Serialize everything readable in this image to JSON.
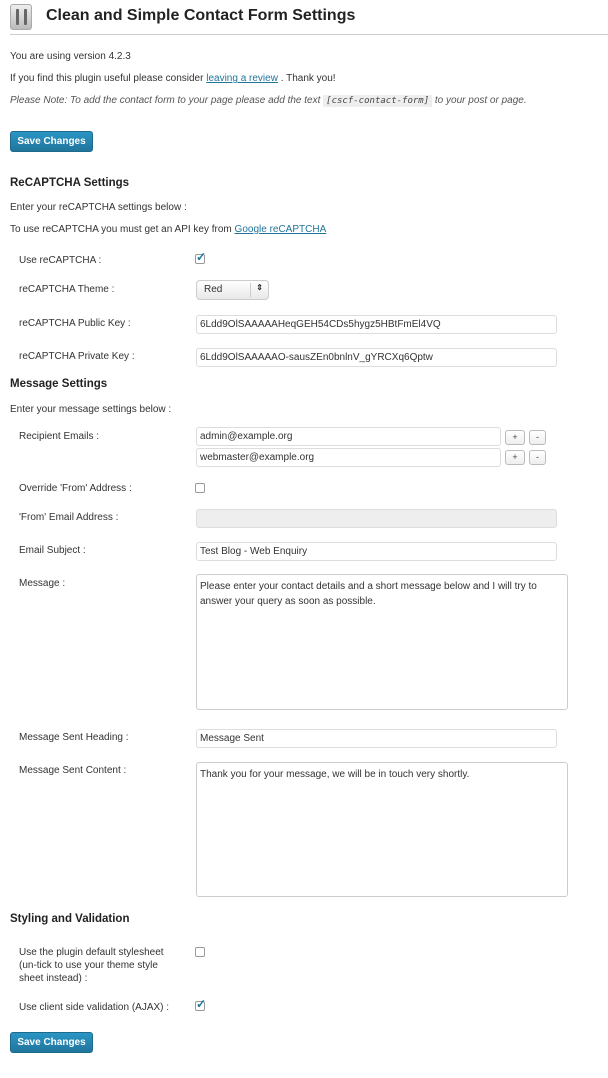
{
  "header": {
    "title": "Clean and Simple Contact Form Settings",
    "icon": "settings-sliders-icon"
  },
  "intro": {
    "version": "You are using version 4.2.3",
    "review_pre": "If you find this plugin useful please consider",
    "review_link": "leaving a review",
    "review_post": ". Thank you!",
    "note_pre": "Please Note: To add the contact form to your page please add the text",
    "shortcode": "[cscf-contact-form]",
    "note_post": "to your post or page."
  },
  "save_label": "Save Changes",
  "recaptcha": {
    "heading": "ReCAPTCHA Settings",
    "intro": "Enter your reCAPTCHA settings below :",
    "api_pre": "To use reCAPTCHA you must get an API key from",
    "api_link": "Google reCAPTCHA",
    "use_label": "Use reCAPTCHA :",
    "use_checked": true,
    "theme_label": "reCAPTCHA Theme :",
    "theme_value": "Red",
    "public_label": "reCAPTCHA Public Key :",
    "public_value": "6Ldd9OlSAAAAAHeqGEH54CDs5hygz5HBtFmEl4VQ",
    "private_label": "reCAPTCHA Private Key :",
    "private_value": "6Ldd9OlSAAAAAO-sausZEn0bnlnV_gYRCXq6Qptw"
  },
  "message": {
    "heading": "Message Settings",
    "intro": "Enter your message settings below :",
    "recipients_label": "Recipient Emails :",
    "recipients": [
      "admin@example.org",
      "webmaster@example.org"
    ],
    "add": "+",
    "remove": "-",
    "override_label": "Override 'From' Address :",
    "override_checked": false,
    "from_label": "'From' Email Address :",
    "from_value": "",
    "subject_label": "Email Subject :",
    "subject_value": "Test Blog -  Web Enquiry",
    "message_label": "Message :",
    "message_value": "Please enter your contact details and a short message below and I will try to answer your query as soon as possible.",
    "sent_heading_label": "Message Sent Heading :",
    "sent_heading_value": "Message Sent",
    "sent_content_label": "Message Sent Content :",
    "sent_content_value": "Thank you for your message, we will be in touch very shortly."
  },
  "styling": {
    "heading": "Styling and Validation",
    "stylesheet_label": "Use the plugin default stylesheet (un-tick to use your theme style sheet instead) :",
    "stylesheet_checked": false,
    "ajax_label": "Use client side validation (AJAX) :",
    "ajax_checked": true
  },
  "colors": {
    "accent": "#21759b",
    "button": "#2a95c5"
  }
}
